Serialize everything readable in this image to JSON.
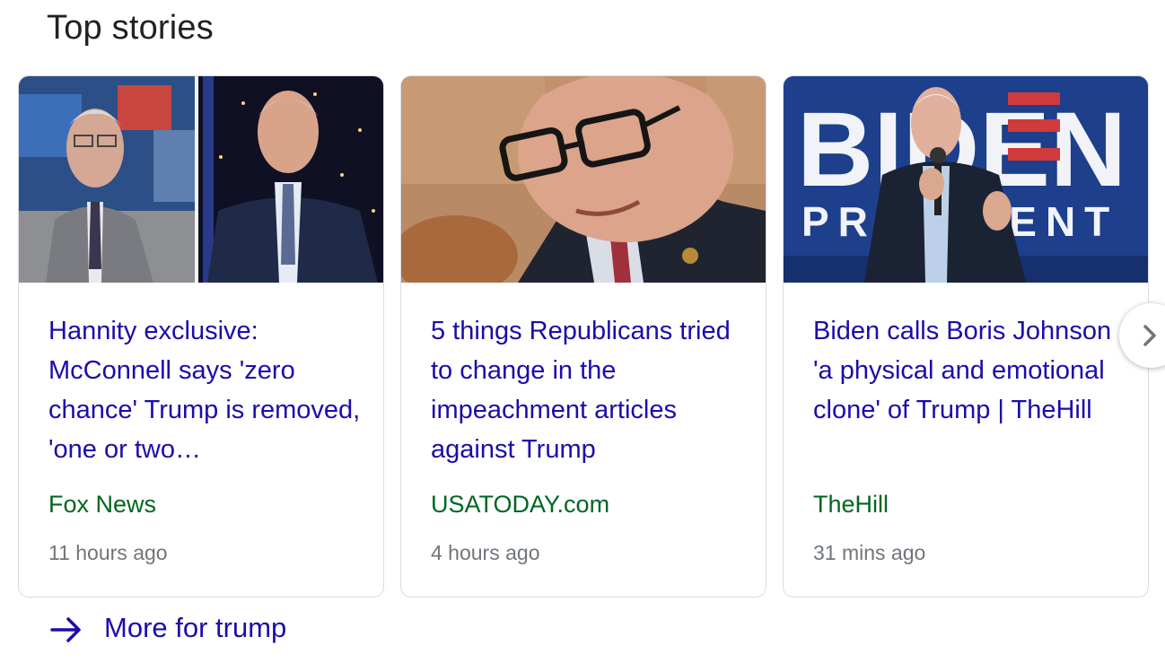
{
  "heading": "Top stories",
  "stories": [
    {
      "title": "Hannity exclusive: McConnell says 'zero chance' Trump is removed, 'one or two…",
      "source": "Fox News",
      "time": "11 hours ago",
      "image_icon": "news-thumbnail-split-interview"
    },
    {
      "title": "5 things Republicans tried to change in the impeachment articles against Trump",
      "source": "USATODAY.com",
      "time": "4 hours ago",
      "image_icon": "news-thumbnail-congressman-glasses"
    },
    {
      "title": "Biden calls Boris Johnson 'a physical and emotional clone' of Trump | TheHill",
      "source": "TheHill",
      "time": "31 mins ago",
      "image_icon": "news-thumbnail-biden-president-sign",
      "image_sign_line1": "BIDEN",
      "image_sign_line2": "PRESIDENT"
    }
  ],
  "more_link": "More for trump",
  "colors": {
    "title": "#1a0dab",
    "source": "#006621",
    "time": "#70757a",
    "heading": "#202124",
    "border": "#dadce0"
  },
  "icons": {
    "next": "chevron-right-icon",
    "more": "arrow-right-icon"
  }
}
